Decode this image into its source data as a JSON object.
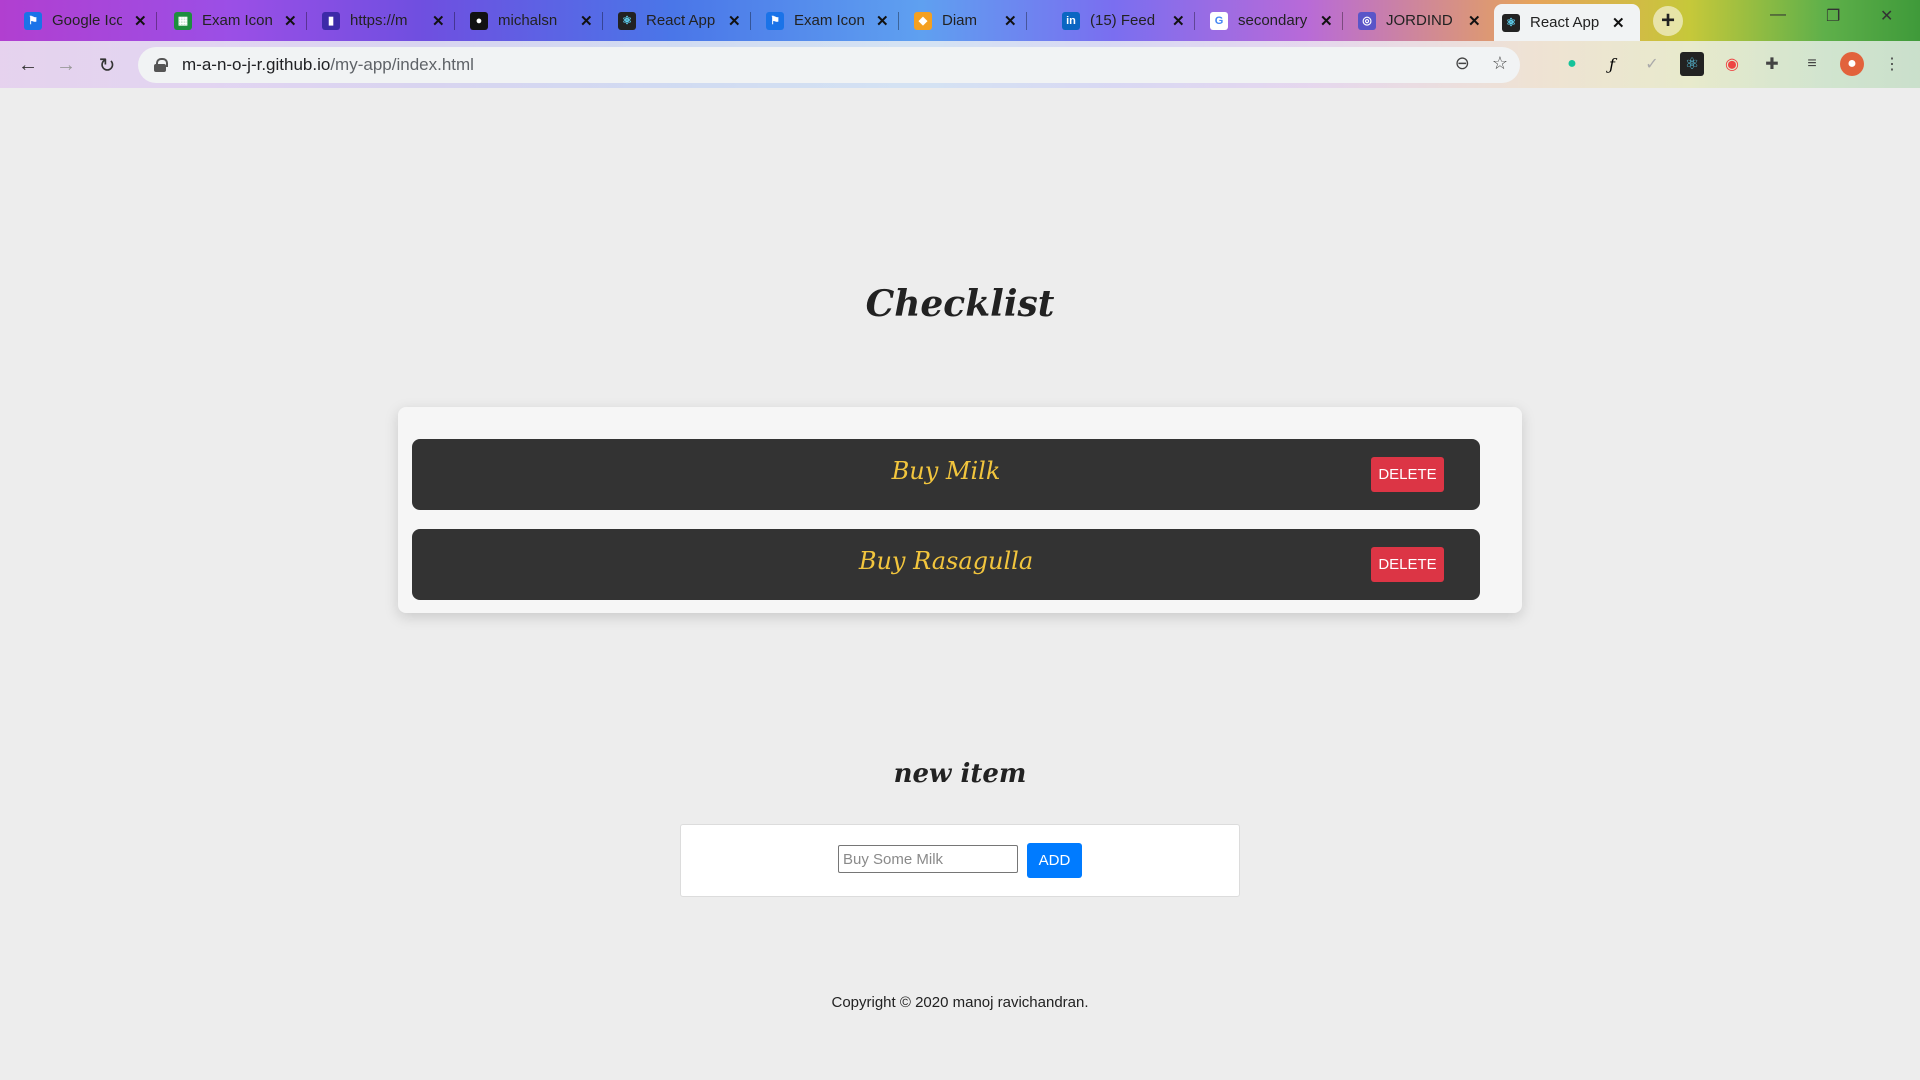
{
  "browser": {
    "tabs": [
      {
        "title": "Google Ico",
        "icon": "flag-icon",
        "color": "#1a73e8"
      },
      {
        "title": "Exam Icon",
        "icon": "sheet-icon",
        "color": "#1e8e3e"
      },
      {
        "title": "https://m",
        "icon": "chart-icon",
        "color": "#3c2aa8"
      },
      {
        "title": "michalsn",
        "icon": "github-icon",
        "color": "#111111"
      },
      {
        "title": "React App",
        "icon": "react-icon",
        "color": "#222222"
      },
      {
        "title": "Exam Icon",
        "icon": "flag-icon",
        "color": "#1a73e8"
      },
      {
        "title": "Diam",
        "icon": "diamond-icon",
        "color": "#f4a020"
      },
      {
        "title": "(15) Feed",
        "icon": "linkedin-icon",
        "color": "#0a66c2"
      },
      {
        "title": "secondary",
        "icon": "google-icon",
        "color": "#4285f4"
      },
      {
        "title": "JORDIND",
        "icon": "globe-icon",
        "color": "#5a55c8"
      },
      {
        "title": "React App",
        "icon": "react-icon",
        "color": "#222222",
        "active": true
      }
    ],
    "new_tab": "+",
    "url_host": "m-a-n-o-j-r.github.io",
    "url_path": "/my-app/index.html"
  },
  "app": {
    "title": "Checklist",
    "items": [
      {
        "text": "Buy Milk",
        "delete_label": "DELETE"
      },
      {
        "text": "Buy Rasagulla",
        "delete_label": "DELETE"
      }
    ],
    "new_item_heading": "new item",
    "input_placeholder": "Buy Some Milk",
    "add_label": "ADD",
    "footer": "Copyright © 2020 manoj ravichandran."
  },
  "colors": {
    "item_bg": "#333333",
    "item_text": "#f2c53d",
    "delete": "#dc3545",
    "add": "#007bff"
  }
}
